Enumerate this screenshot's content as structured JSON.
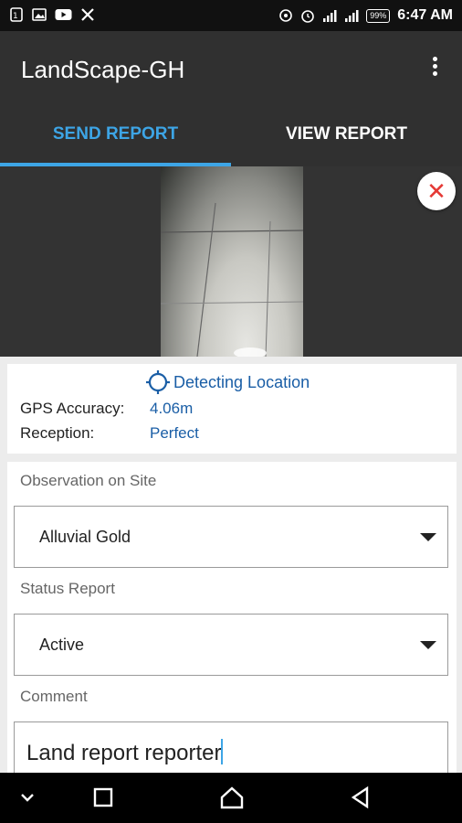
{
  "status_bar": {
    "time": "6:47 AM",
    "battery": "99%",
    "left_icons": [
      "sim-icon",
      "gallery-icon",
      "youtube-icon",
      "x-icon"
    ],
    "right_icons": [
      "location-icon",
      "alarm-icon",
      "signal-icon",
      "signal-icon",
      "battery-icon"
    ]
  },
  "app_bar": {
    "title": "LandScape-GH",
    "tabs": [
      {
        "label": "SEND REPORT",
        "active": true
      },
      {
        "label": "VIEW REPORT",
        "active": false
      }
    ],
    "accent": "#3da5e6"
  },
  "location": {
    "status": "Detecting Location",
    "gps_label": "GPS Accuracy:",
    "gps_value": "4.06m",
    "reception_label": "Reception:",
    "reception_value": "Perfect"
  },
  "form": {
    "observation_label": "Observation on Site",
    "observation_value": "Alluvial Gold",
    "status_label": "Status Report",
    "status_value": "Active",
    "comment_label": "Comment",
    "comment_value": "Land report reporter"
  },
  "nav": {
    "buttons": [
      "chevron-down-icon",
      "recents-icon",
      "home-icon",
      "back-icon"
    ]
  }
}
